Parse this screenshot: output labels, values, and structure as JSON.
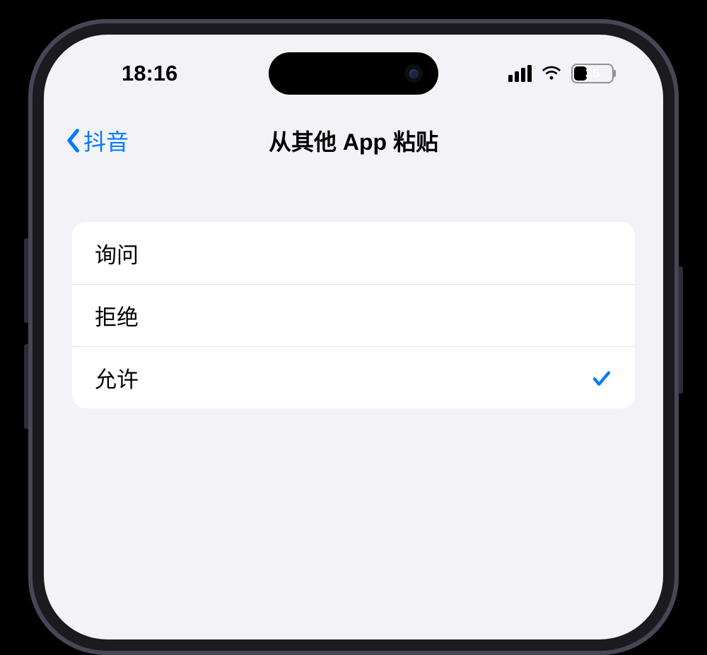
{
  "status": {
    "time": "18:16",
    "battery_percent": "35"
  },
  "nav": {
    "back_label": "抖音",
    "title": "从其他 App 粘贴"
  },
  "options": {
    "item0": {
      "label": "询问",
      "selected": false
    },
    "item1": {
      "label": "拒绝",
      "selected": false
    },
    "item2": {
      "label": "允许",
      "selected": true
    }
  }
}
